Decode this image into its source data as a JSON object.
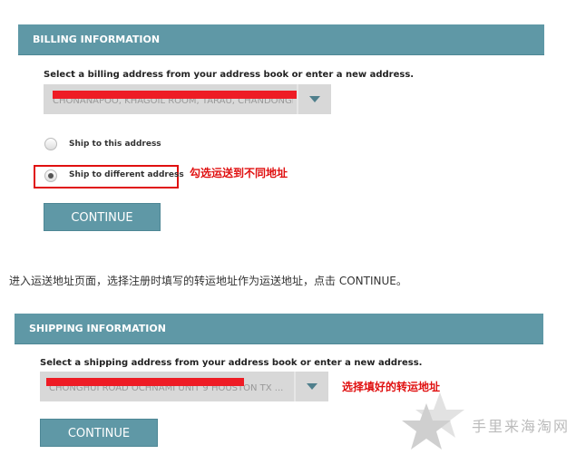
{
  "billing": {
    "title": "BILLING INFORMATION",
    "label": "Select a billing address from your address book or enter a new address.",
    "address": "CHONANAPOO, KHAGOIL ROOM, TARAU, CHANDONGKI",
    "radio_options": [
      "Ship to this address",
      "Ship to different address"
    ],
    "selected_option": "Ship to different address",
    "note": "勾选运送到不同地址",
    "continue": "CONTINUE"
  },
  "instruction": "进入运送地址页面，选择注册时填写的转运地址作为运送地址，点击 CONTINUE。",
  "shipping": {
    "title": "SHIPPING INFORMATION",
    "label": "Select a shipping address from your address book or enter a new address.",
    "address": "CHONGHUI ROAD OCHNAMI UNIT 9 HOUSTON TX ...",
    "note": "选择填好的转运地址",
    "continue": "CONTINUE"
  },
  "watermark": "手里来海淘网",
  "colors": {
    "accent": "#5f98a6",
    "annotation": "#e01010"
  }
}
